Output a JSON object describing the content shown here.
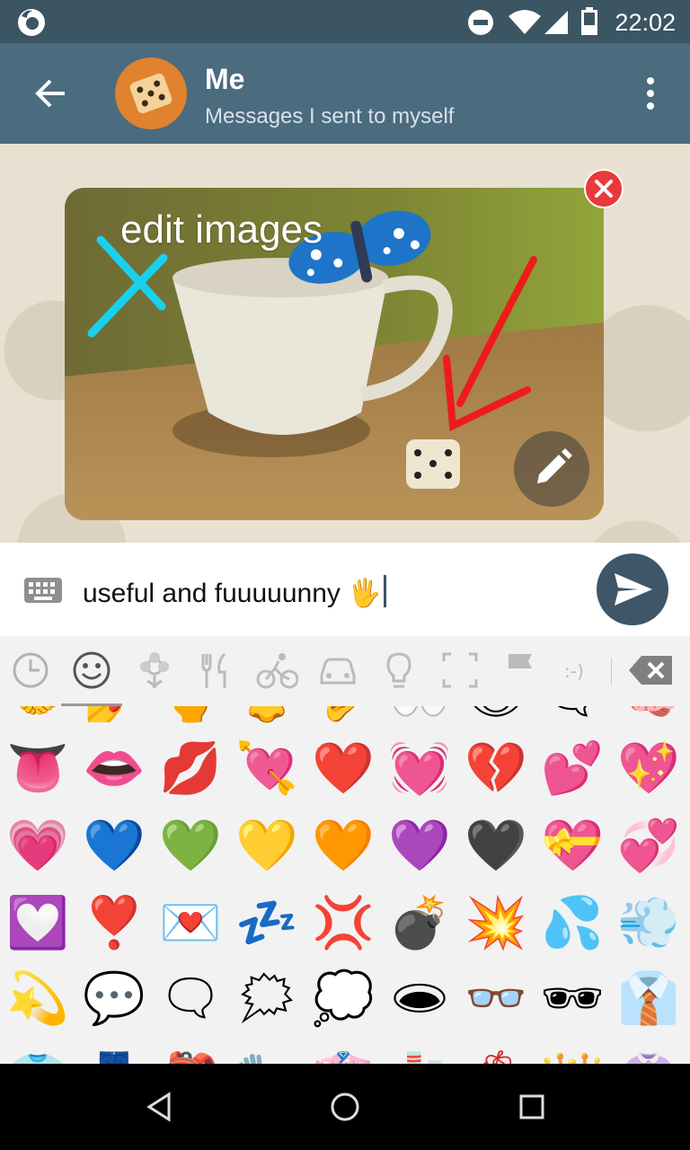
{
  "status_bar": {
    "time": "22:02"
  },
  "header": {
    "title": "Me",
    "subtitle": "Messages I sent to myself",
    "back_icon": "arrow-left-icon",
    "menu_icon": "more-vertical-icon"
  },
  "photo": {
    "caption": "edit images"
  },
  "input": {
    "text": "useful and fuuuuunny ",
    "emoji": "🖐"
  },
  "emoji_tabs": [
    "recent",
    "smileys",
    "nature",
    "food",
    "activity",
    "travel",
    "objects",
    "symbols",
    "flags",
    "emoticons",
    "backspace"
  ],
  "emoji_rows": [
    [
      "🤝",
      "💅",
      "🖕",
      "👃",
      "👂",
      "👀",
      "👁",
      "🗨",
      "🧠"
    ],
    [
      "👅",
      "👄",
      "💋",
      "💘",
      "❤️",
      "💓",
      "💔",
      "💕",
      "💖"
    ],
    [
      "💗",
      "💙",
      "💚",
      "💛",
      "🧡",
      "💜",
      "🖤",
      "💝",
      "💞"
    ],
    [
      "💟",
      "❣️",
      "💌",
      "💤",
      "💢",
      "💣",
      "💥",
      "💦",
      "💨"
    ],
    [
      "💫",
      "💬",
      "🗨",
      "🗯",
      "💭",
      "🕳",
      "👓",
      "🕶",
      "👔"
    ],
    [
      "👕",
      "👖",
      "🎒",
      "🧤",
      "👘",
      "🧦",
      "👙",
      "👑",
      "👚"
    ]
  ],
  "colors": {
    "header": "#4b6b7e",
    "status_bar": "#3b5563",
    "send_button": "#3e5667",
    "remove_button": "#e8393b"
  }
}
